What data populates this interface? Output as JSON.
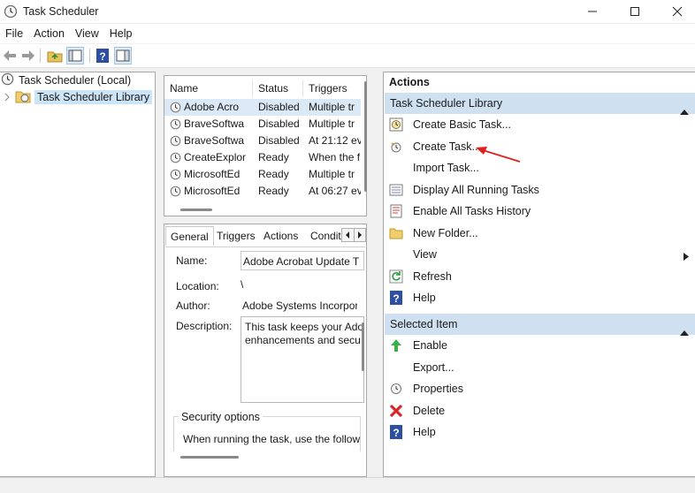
{
  "window": {
    "title": "Task Scheduler"
  },
  "menu": [
    "File",
    "Action",
    "View",
    "Help"
  ],
  "toolbar": {
    "icons": [
      "back-arrow-icon",
      "forward-arrow-icon",
      "up-folder-icon",
      "show-hide-tree-icon",
      "help-icon",
      "show-hide-action-pane-icon"
    ]
  },
  "tree": {
    "root": "Task Scheduler (Local)",
    "child": "Task Scheduler Library"
  },
  "tasklist": {
    "headers": [
      "Name",
      "Status",
      "Triggers"
    ],
    "rows": [
      {
        "name": "Adobe Acro",
        "status": "Disabled",
        "triggers": "Multiple tr"
      },
      {
        "name": "BraveSoftwa",
        "status": "Disabled",
        "triggers": "Multiple tr"
      },
      {
        "name": "BraveSoftwa",
        "status": "Disabled",
        "triggers": "At 21:12 ev"
      },
      {
        "name": "CreateExplor",
        "status": "Ready",
        "triggers": "When the f"
      },
      {
        "name": "MicrosoftEd",
        "status": "Ready",
        "triggers": "Multiple tr"
      },
      {
        "name": "MicrosoftEd",
        "status": "Ready",
        "triggers": "At 06:27 ev"
      }
    ]
  },
  "details": {
    "tabs": [
      "General",
      "Triggers",
      "Actions",
      "Condit"
    ],
    "name_label": "Name:",
    "name_value": "Adobe Acrobat Update T",
    "location_label": "Location:",
    "location_value": "\\",
    "author_label": "Author:",
    "author_value": "Adobe Systems Incorpor",
    "description_label": "Description:",
    "description_line1": "This task keeps your Ado",
    "description_line2": "enhancements and secu",
    "security_title": "Security options",
    "security_text": "When running the task, use the follow"
  },
  "actions": {
    "title": "Actions",
    "section1": "Task Scheduler Library",
    "items1": [
      {
        "label": "Create Basic Task...",
        "icon": "create-basic-task-icon"
      },
      {
        "label": "Create Task...",
        "icon": "create-task-icon"
      },
      {
        "label": "Import Task...",
        "icon": ""
      },
      {
        "label": "Display All Running Tasks",
        "icon": "running-tasks-icon"
      },
      {
        "label": "Enable All Tasks History",
        "icon": "tasks-history-icon"
      },
      {
        "label": "New Folder...",
        "icon": "folder-icon"
      },
      {
        "label": "View",
        "icon": ""
      },
      {
        "label": "Refresh",
        "icon": "refresh-icon"
      },
      {
        "label": "Help",
        "icon": "help-icon"
      }
    ],
    "section2": "Selected Item",
    "items2": [
      {
        "label": "Enable",
        "icon": "enable-arrow-icon"
      },
      {
        "label": "Export...",
        "icon": ""
      },
      {
        "label": "Properties",
        "icon": "properties-icon"
      },
      {
        "label": "Delete",
        "icon": "delete-icon"
      },
      {
        "label": "Help",
        "icon": "help-icon"
      }
    ]
  },
  "colors": {
    "section_header": "#cfe0f1",
    "annotation_arrow": "#e0201e",
    "help_icon": "#2c4fa3"
  }
}
